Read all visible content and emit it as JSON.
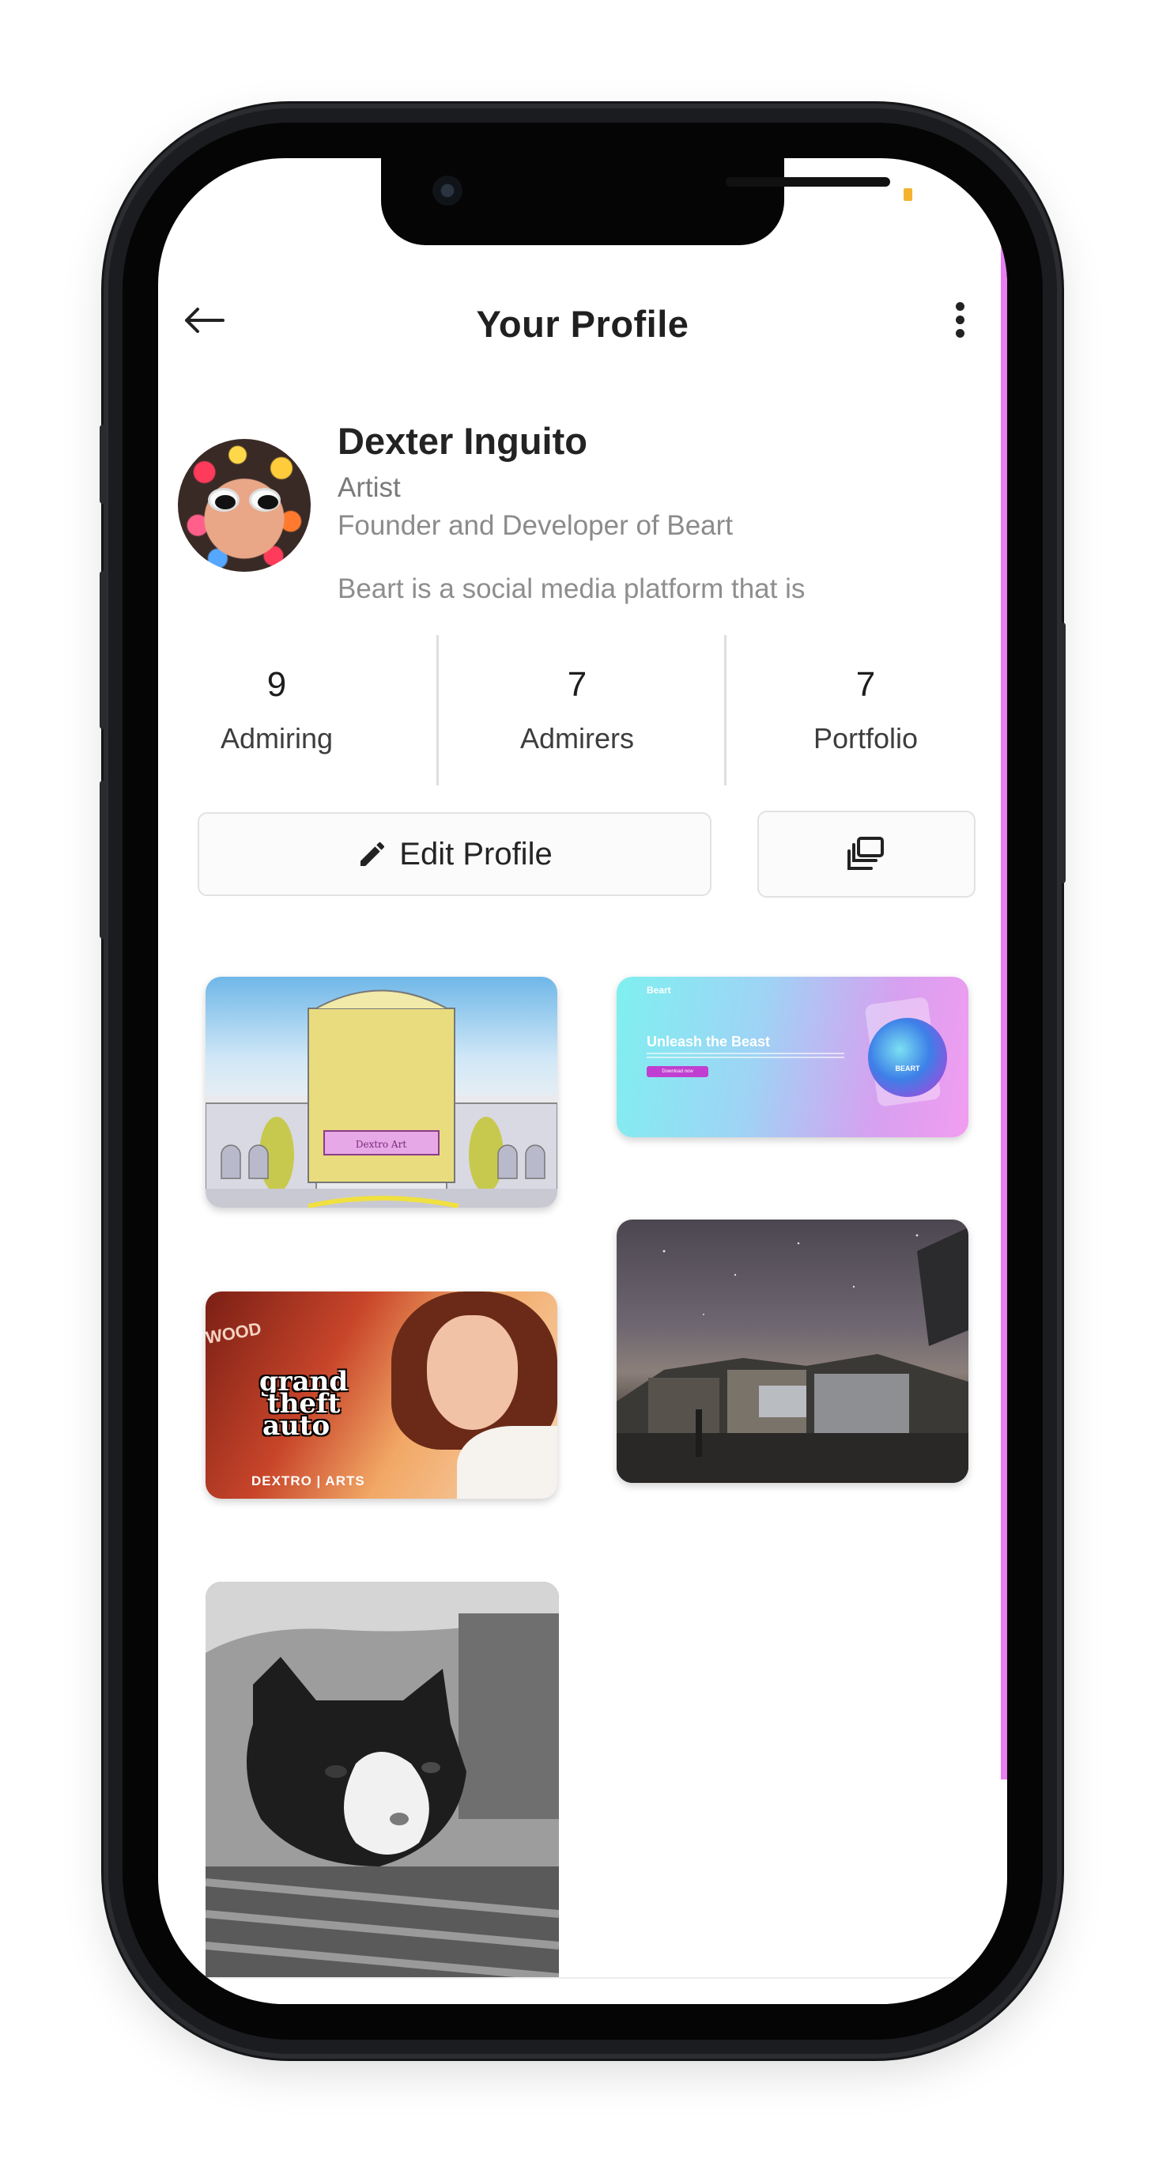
{
  "header": {
    "title": "Your Profile",
    "back_icon": "arrow-left-icon",
    "menu_icon": "more-vertical-icon"
  },
  "profile": {
    "name": "Dexter Inguito",
    "role": "Artist",
    "tagline": "Founder and Developer of Beart",
    "bio": "Beart is a social media platform that is"
  },
  "stats": [
    {
      "value": "9",
      "label": "Admiring"
    },
    {
      "value": "7",
      "label": "Admirers"
    },
    {
      "value": "7",
      "label": "Portfolio"
    }
  ],
  "actions": {
    "edit_label": "Edit Profile",
    "edit_icon": "pencil-icon",
    "gallery_icon": "gallery-stack-icon"
  },
  "gallery": {
    "art1_caption": "Dextro Art",
    "art2": {
      "brand": "Beart",
      "heading": "Unleash the Beast",
      "button": "Download now",
      "badge": "BEART"
    },
    "art4": {
      "logo_line1": "grand",
      "logo_line2": "theft",
      "logo_line3": "auto",
      "signature": "DEXTRO | ARTS",
      "sign_text": "WOOD"
    }
  },
  "navbar": {
    "recents_icon": "square-icon",
    "home_icon": "circle-home-icon",
    "back_icon": "triangle-back-icon"
  },
  "colors": {
    "accent": "#e87ef0",
    "status_dot": "#f4b22f"
  }
}
